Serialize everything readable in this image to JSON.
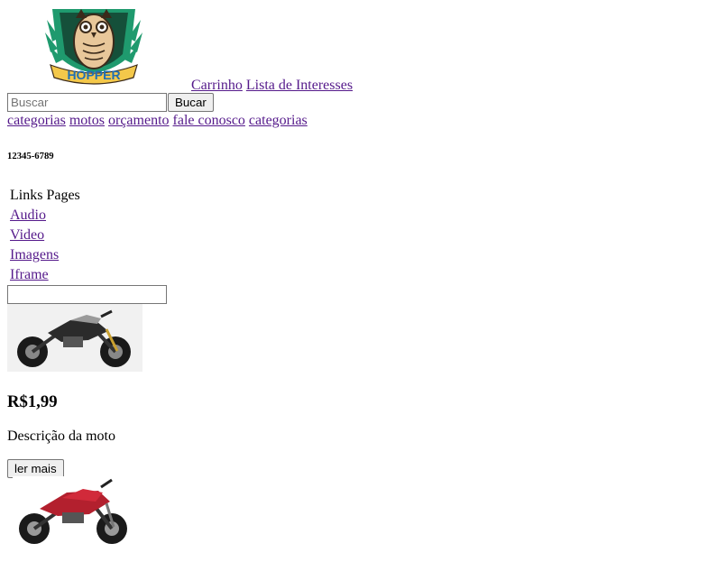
{
  "logo": {
    "text": "HOPPER",
    "icon": "owl-shield-logo",
    "colors": {
      "green": "#1f9a6e",
      "dark": "#15503a",
      "ribbon": "#f4c84a"
    }
  },
  "header": {
    "links": [
      "Carrinho",
      "Lista de Interesses"
    ]
  },
  "search": {
    "placeholder": "Buscar",
    "button": "Bucar"
  },
  "nav": {
    "items": [
      "categorias",
      "motos",
      "orçamento",
      "fale conosco",
      "categorias"
    ]
  },
  "contact": {
    "phone": "12345-6789"
  },
  "pages": {
    "title": "Links Pages",
    "links": [
      "Audio",
      "Video",
      "Imagens",
      "Iframe"
    ]
  },
  "form": {
    "value": ""
  },
  "products": [
    {
      "image": "motorcycle-black-photo",
      "price": "R$1,99",
      "description": "Descrição da moto",
      "button": "ler mais"
    },
    {
      "image": "motorcycle-red-photo"
    }
  ]
}
